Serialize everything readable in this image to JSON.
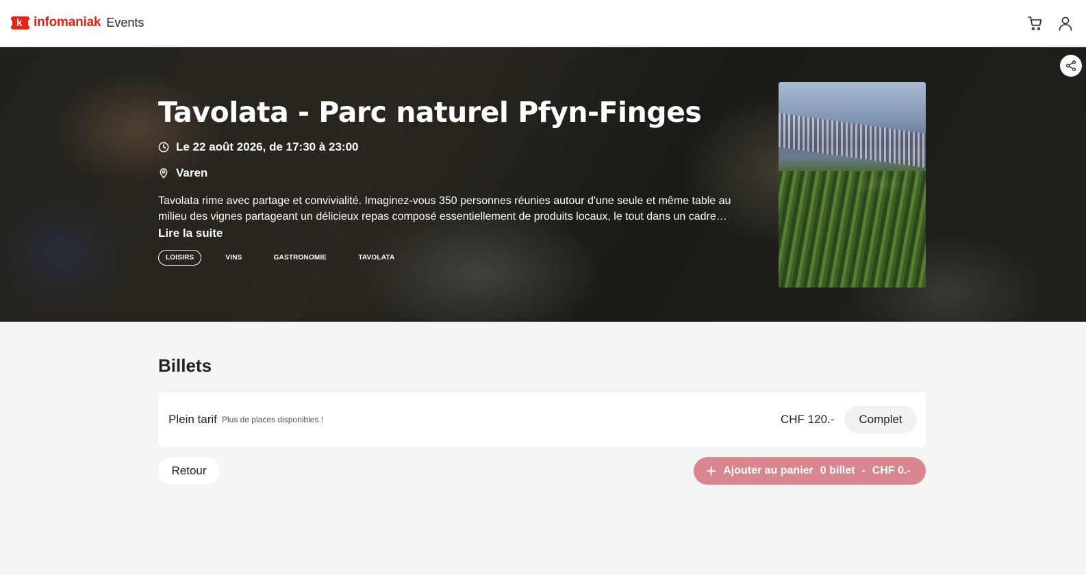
{
  "header": {
    "brand": "infomaniak",
    "brand_mark": "k",
    "suffix": "Events",
    "icons": [
      "cart-icon",
      "user-icon"
    ]
  },
  "event": {
    "title": "Tavolata - Parc naturel Pfyn-Finges",
    "datetime": "Le 22 août 2026, de 17:30 à 23:00",
    "location": "Varen",
    "description_line1": "Tavolata rime avec partage et convivialité. Imaginez-vous 350 personnes réunies autour d'une seule et même table au",
    "description_line2": "milieu des vignes partageant un délicieux repas composé essentiellement de produits locaux, le tout dans un cadre…",
    "read_more": "Lire la suite",
    "tags": [
      "LOISIRS",
      "VINS",
      "GASTRONOMIE",
      "TAVOLATA"
    ],
    "active_tag_index": 0
  },
  "tickets": {
    "section_title": "Billets",
    "items": [
      {
        "name": "Plein tarif",
        "note": "Plus de places disponibles !",
        "price": "CHF 120.-",
        "status": "Complet"
      }
    ]
  },
  "actions": {
    "back_label": "Retour",
    "add_to_cart_label": "Ajouter au panier",
    "ticket_count": "0 billet",
    "separator": "-",
    "total": "CHF 0.-"
  },
  "colors": {
    "brand_red": "#e2231a",
    "cart_button_bg": "#d8868d",
    "page_bg": "#f4f4f4"
  }
}
